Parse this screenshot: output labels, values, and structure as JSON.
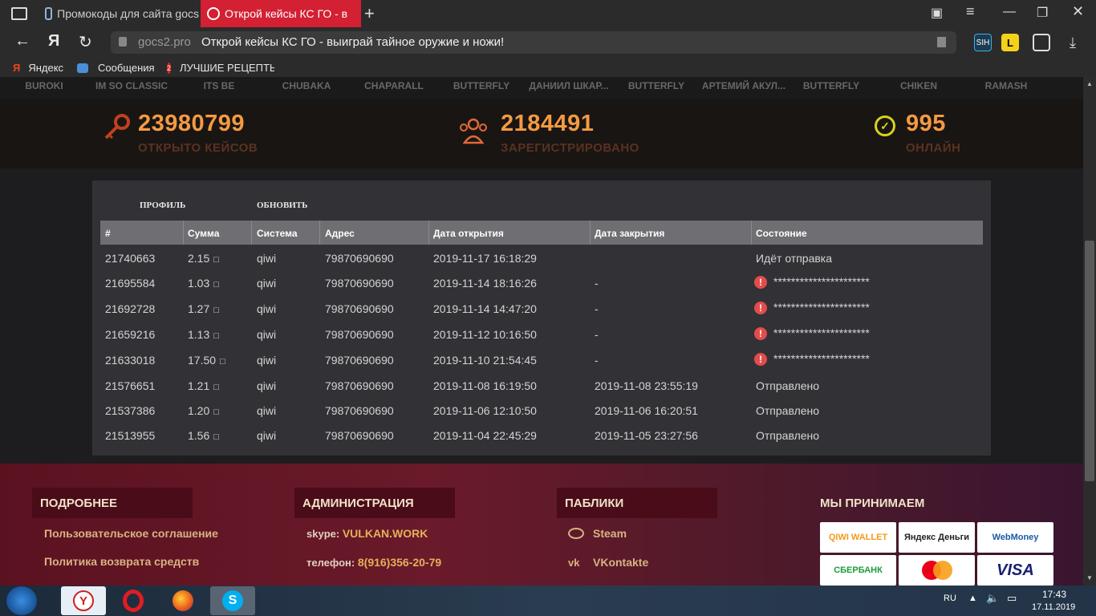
{
  "browser": {
    "tabs": [
      {
        "label": "Промокоды для сайта gocs",
        "active": false
      },
      {
        "label": "Открой кейсы КС ГО - в",
        "active": true
      }
    ],
    "url_domain": "gocs2.pro",
    "url_title": "Открой кейсы КС ГО - выиграй тайное оружие и ножи!",
    "yandex_glyph": "Я",
    "ext_badge": "SIH"
  },
  "bookmarks": [
    {
      "label": "Яндекс",
      "icon": "yandex-icon"
    },
    {
      "label": "Сообщения",
      "icon": "messages-icon"
    },
    {
      "label": "ЛУЧШИЕ РЕЦЕПТЫ",
      "icon": "recipes-icon",
      "badge": "2"
    }
  ],
  "live_drops": [
    "BUROKI",
    "IM SO CLASSIC",
    "ITS BE",
    "CHUBAKA",
    "CHAPARALL",
    "BUTTERFLY",
    "ДАНИИЛ ШКАР...",
    "BUTTERFLY",
    "АРТЕМИЙ АКУЛ...",
    "BUTTERFLY",
    "CHIKEN",
    "RAMASH"
  ],
  "stats": [
    {
      "value": "23980799",
      "label": "ОТКРЫТО КЕЙСОВ",
      "icon": "key-icon"
    },
    {
      "value": "2184491",
      "label": "ЗАРЕГИСТРИРОВАНО",
      "icon": "users-icon"
    },
    {
      "value": "995",
      "label": "ОНЛАЙН",
      "icon": "check-circle-icon"
    }
  ],
  "panel": {
    "links": [
      "ПРОФИЛЬ",
      "ОБНОВИТЬ"
    ],
    "columns": [
      "#",
      "Сумма",
      "Система",
      "Адрес",
      "Дата открытия",
      "Дата закрытия",
      "Состояние"
    ],
    "currency_glyph": "□",
    "rows": [
      {
        "id": "21740663",
        "amount": "2.15",
        "system": "qiwi",
        "address": "79870690690",
        "opened": "2019-11-17 16:18:29",
        "closed": "",
        "status": "Идёт отправка",
        "error": false
      },
      {
        "id": "21695584",
        "amount": "1.03",
        "system": "qiwi",
        "address": "79870690690",
        "opened": "2019-11-14 18:16:26",
        "closed": "-",
        "status": "**********************",
        "error": true
      },
      {
        "id": "21692728",
        "amount": "1.27",
        "system": "qiwi",
        "address": "79870690690",
        "opened": "2019-11-14 14:47:20",
        "closed": "-",
        "status": "**********************",
        "error": true
      },
      {
        "id": "21659216",
        "amount": "1.13",
        "system": "qiwi",
        "address": "79870690690",
        "opened": "2019-11-12 10:16:50",
        "closed": "-",
        "status": "**********************",
        "error": true
      },
      {
        "id": "21633018",
        "amount": "17.50",
        "system": "qiwi",
        "address": "79870690690",
        "opened": "2019-11-10 21:54:45",
        "closed": "-",
        "status": "**********************",
        "error": true
      },
      {
        "id": "21576651",
        "amount": "1.21",
        "system": "qiwi",
        "address": "79870690690",
        "opened": "2019-11-08 16:19:50",
        "closed": "2019-11-08 23:55:19",
        "status": "Отправлено",
        "error": false
      },
      {
        "id": "21537386",
        "amount": "1.20",
        "system": "qiwi",
        "address": "79870690690",
        "opened": "2019-11-06 12:10:50",
        "closed": "2019-11-06 16:20:51",
        "status": "Отправлено",
        "error": false
      },
      {
        "id": "21513955",
        "amount": "1.56",
        "system": "qiwi",
        "address": "79870690690",
        "opened": "2019-11-04 22:45:29",
        "closed": "2019-11-05 23:27:56",
        "status": "Отправлено",
        "error": false
      }
    ]
  },
  "footer": {
    "about": {
      "title": "ПОДРОБНЕЕ",
      "links": [
        "Пользовательское соглашение",
        "Политика возврата средств"
      ]
    },
    "admin": {
      "title": "АДМИНИСТРАЦИЯ",
      "skype_label": "skype:",
      "skype_value": "VULKAN.WORK",
      "phone_label": "телефон:",
      "phone_value": "8(916)356-20-79"
    },
    "publics": {
      "title": "ПАБЛИКИ",
      "links": [
        "Steam",
        "VKontakte"
      ]
    },
    "payments": {
      "title": "МЫ ПРИНИМАЕМ",
      "qiwi": "QIWI WALLET",
      "yandex": "Яндекс Деньги",
      "webmoney": "WebMoney",
      "sber": "СБЕРБАНК",
      "visa": "VISA"
    }
  },
  "taskbar": {
    "lang": "RU",
    "time": "17:43",
    "date": "17.11.2019"
  }
}
